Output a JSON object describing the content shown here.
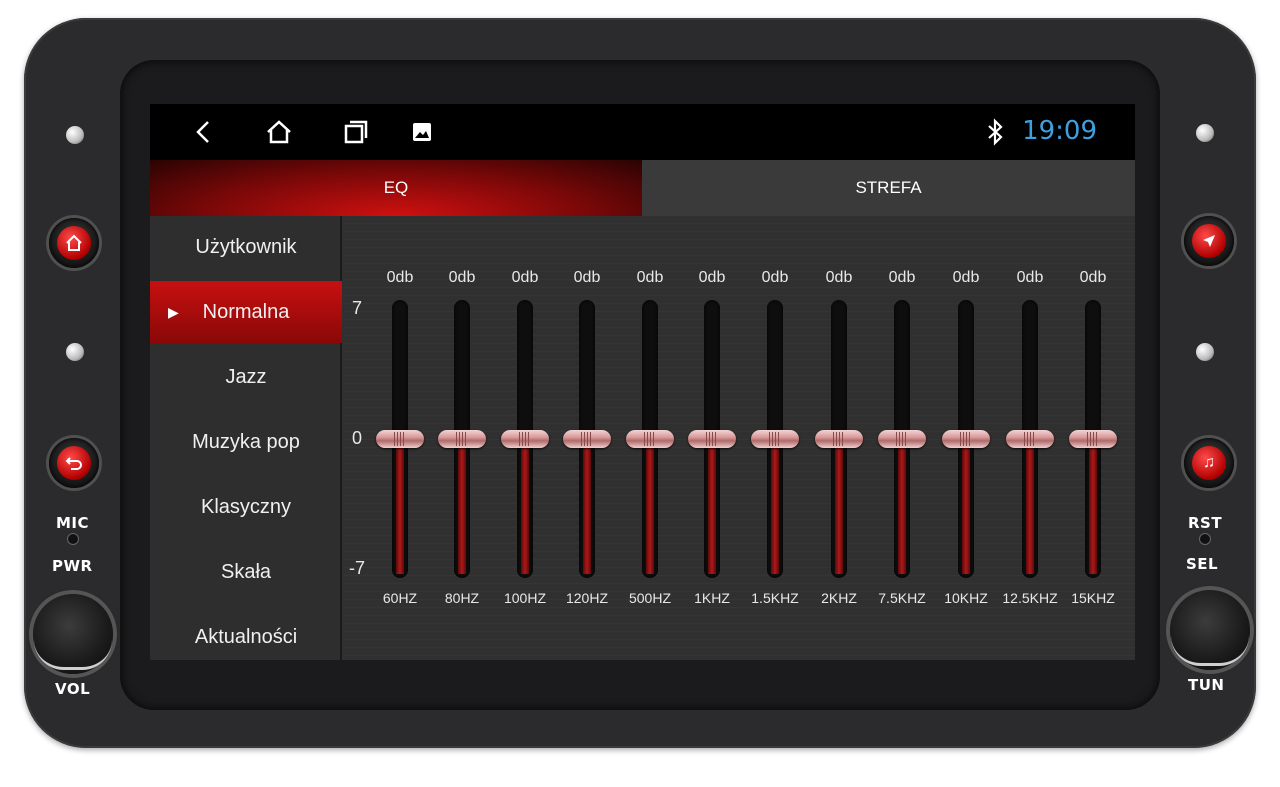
{
  "status_bar": {
    "icons": [
      "back-icon",
      "home-icon",
      "recent-apps-icon",
      "gallery-icon",
      "bluetooth-icon"
    ],
    "time": "19:09",
    "time_color": "#3fa0e0"
  },
  "tabs": [
    {
      "label": "EQ",
      "active": true
    },
    {
      "label": "STREFA",
      "active": false
    }
  ],
  "presets": [
    {
      "label": "Użytkownik",
      "active": false
    },
    {
      "label": "Normalna",
      "active": true
    },
    {
      "label": "Jazz",
      "active": false
    },
    {
      "label": "Muzyka pop",
      "active": false
    },
    {
      "label": "Klasyczny",
      "active": false
    },
    {
      "label": "Skała",
      "active": false
    },
    {
      "label": "Aktualności",
      "active": false
    }
  ],
  "eq": {
    "scale": {
      "max": "7",
      "mid": "0",
      "min": "-7"
    },
    "bands": [
      {
        "freq": "60HZ",
        "gain": "0db",
        "value": 0
      },
      {
        "freq": "80HZ",
        "gain": "0db",
        "value": 0
      },
      {
        "freq": "100HZ",
        "gain": "0db",
        "value": 0
      },
      {
        "freq": "120HZ",
        "gain": "0db",
        "value": 0
      },
      {
        "freq": "500HZ",
        "gain": "0db",
        "value": 0
      },
      {
        "freq": "1KHZ",
        "gain": "0db",
        "value": 0
      },
      {
        "freq": "1.5KHZ",
        "gain": "0db",
        "value": 0
      },
      {
        "freq": "2KHZ",
        "gain": "0db",
        "value": 0
      },
      {
        "freq": "7.5KHZ",
        "gain": "0db",
        "value": 0
      },
      {
        "freq": "10KHZ",
        "gain": "0db",
        "value": 0
      },
      {
        "freq": "12.5KHZ",
        "gain": "0db",
        "value": 0
      },
      {
        "freq": "15KHZ",
        "gain": "0db",
        "value": 0
      }
    ]
  },
  "hardware": {
    "labels": {
      "mic": "MIC",
      "pwr": "PWR",
      "vol": "VOL",
      "rst": "RST",
      "sel": "SEL",
      "tun": "TUN"
    },
    "left_buttons": [
      "home-icon",
      "back-icon"
    ],
    "right_buttons": [
      "navigation-icon",
      "music-icon"
    ],
    "accent": "#c81010"
  }
}
